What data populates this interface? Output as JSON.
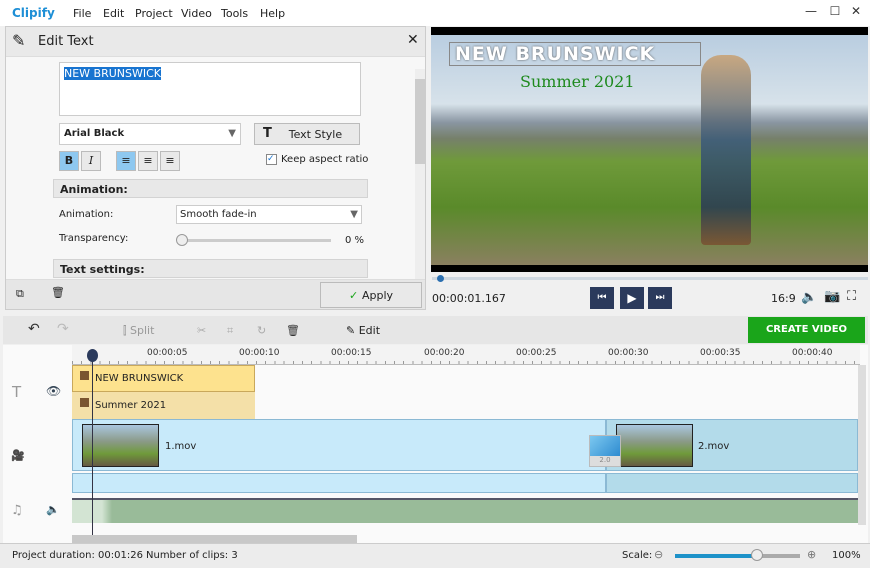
{
  "app": {
    "name": "Clipify",
    "menu": [
      "File",
      "Edit",
      "Project",
      "Video",
      "Tools",
      "Help"
    ],
    "window_controls": [
      "minimize",
      "maximize",
      "close"
    ]
  },
  "edit_panel": {
    "title": "Edit Text",
    "text_value": "NEW BRUNSWICK",
    "font": "Arial Black",
    "text_style_label": "Text Style",
    "bold_label": "B",
    "italic_label": "I",
    "keep_aspect_label": "Keep aspect ratio",
    "keep_aspect_checked": true,
    "animation_section": "Animation:",
    "animation_label": "Animation:",
    "animation_value": "Smooth fade-in",
    "transparency_label": "Transparency:",
    "transparency_value": "0 %",
    "transparency_percent": 0,
    "text_settings_section": "Text settings:",
    "apply_label": "Apply"
  },
  "preview": {
    "title_text": "NEW BRUNSWICK",
    "subtitle_text": "Summer 2021",
    "subtitle_color": "#1e8a1e",
    "timecode": "00:00:01.167",
    "aspect": "16:9"
  },
  "toolbar": {
    "split_label": "Split",
    "edit_label": "Edit",
    "create_video_label": "CREATE VIDEO",
    "create_color": "#1aa51a"
  },
  "timeline": {
    "ticks": [
      "00:00:05",
      "00:00:10",
      "00:00:15",
      "00:00:20",
      "00:00:25",
      "00:00:30",
      "00:00:35",
      "00:00:40"
    ],
    "text_clips": [
      "NEW BRUNSWICK",
      "Summer 2021"
    ],
    "video_clips": [
      "1.mov",
      "2.mov"
    ],
    "transition_duration": "2.0"
  },
  "status": {
    "duration": "Project duration:  00:01:26",
    "clips": "Number of clips: 3",
    "scale_label": "Scale:",
    "scale_value": "100%"
  }
}
